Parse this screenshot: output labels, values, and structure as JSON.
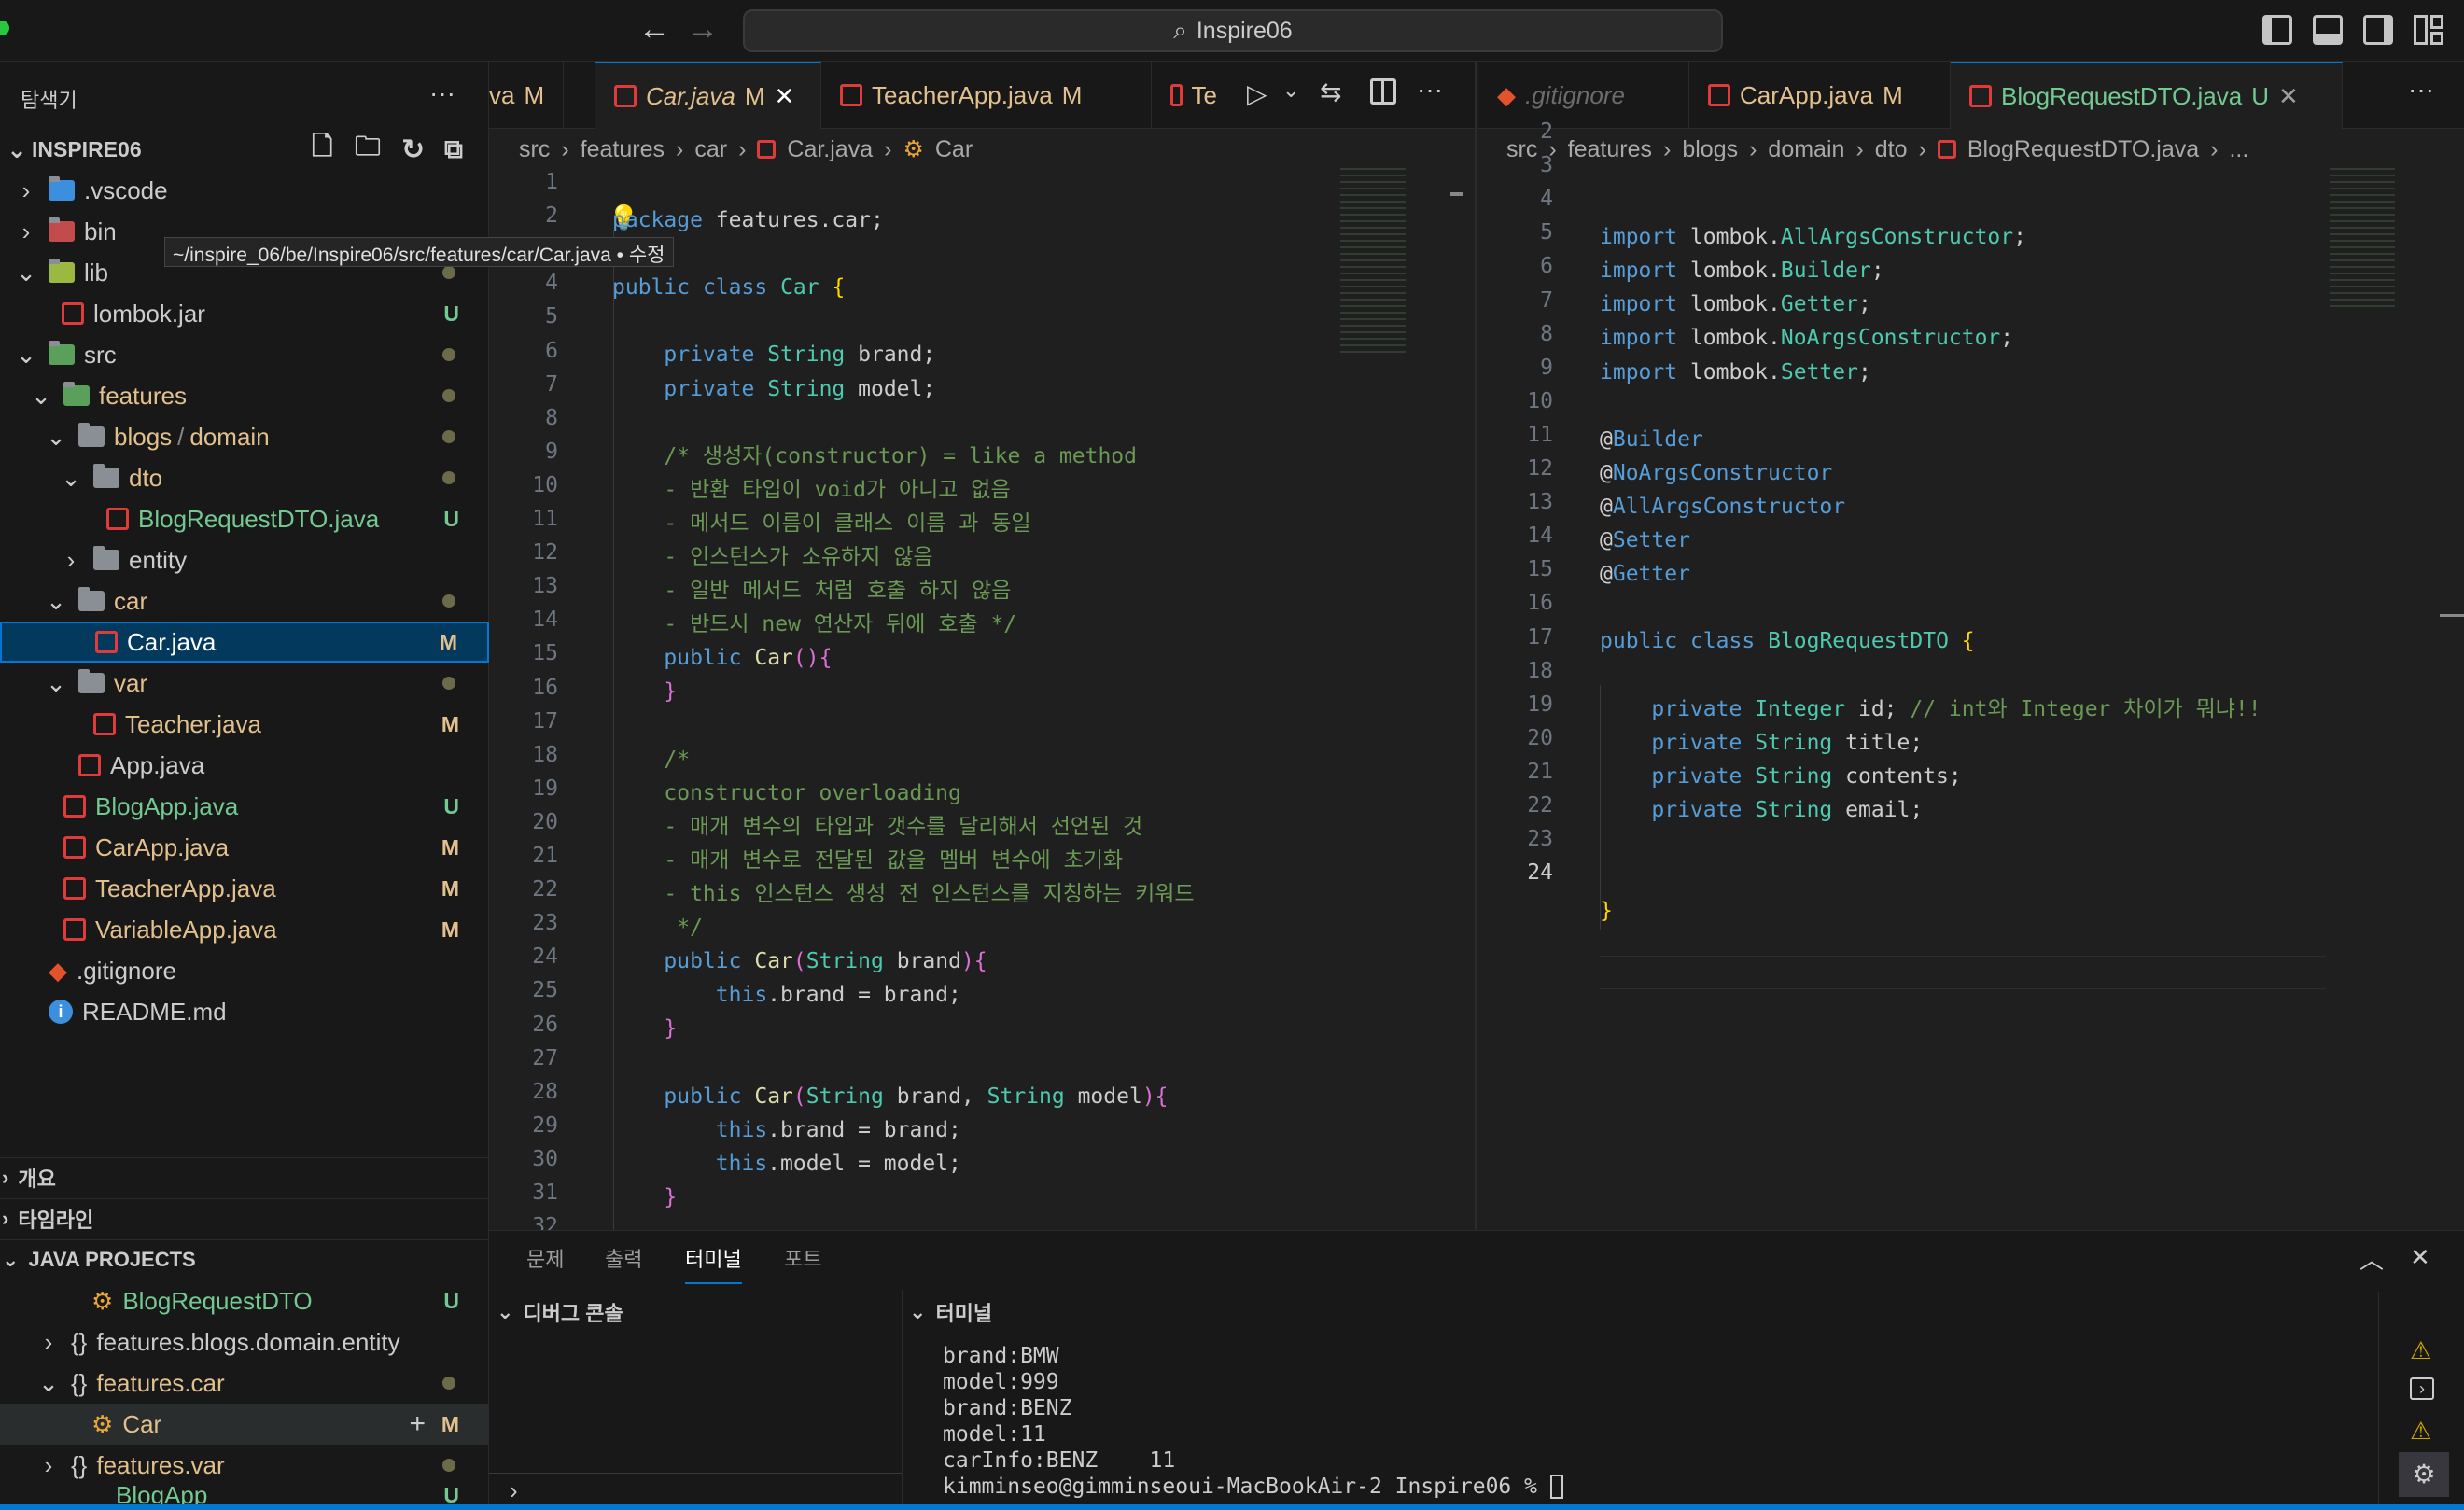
{
  "titlebar": {
    "search_text": "Inspire06"
  },
  "explorer": {
    "title": "탐색기",
    "more": "···",
    "root": "INSPIRE06",
    "tooltip": "~/inspire_06/be/Inspire06/src/features/car/Car.java • 수정",
    "items": [
      {
        "label": ".vscode",
        "badge": ""
      },
      {
        "label": "bin",
        "badge": ""
      },
      {
        "label": "lib",
        "badge": ""
      },
      {
        "label": "lombok.jar",
        "badge": "U"
      },
      {
        "label": "src",
        "badge": ""
      },
      {
        "label": "features",
        "badge": ""
      },
      {
        "label": "blogs",
        "label2": "domain",
        "badge": ""
      },
      {
        "label": "dto",
        "badge": ""
      },
      {
        "label": "BlogRequestDTO.java",
        "badge": "U"
      },
      {
        "label": "entity",
        "badge": ""
      },
      {
        "label": "car",
        "badge": ""
      },
      {
        "label": "Car.java",
        "badge": "M"
      },
      {
        "label": "var",
        "badge": ""
      },
      {
        "label": "Teacher.java",
        "badge": "M"
      },
      {
        "label": "App.java",
        "badge": ""
      },
      {
        "label": "BlogApp.java",
        "badge": "U"
      },
      {
        "label": "CarApp.java",
        "badge": "M"
      },
      {
        "label": "TeacherApp.java",
        "badge": "M"
      },
      {
        "label": "VariableApp.java",
        "badge": "M"
      },
      {
        "label": ".gitignore",
        "badge": ""
      },
      {
        "label": "README.md",
        "badge": ""
      }
    ],
    "sections": {
      "outline": "개요",
      "timeline": "타임라인",
      "java_projects": "JAVA PROJECTS"
    },
    "java_items": [
      {
        "label": "BlogRequestDTO",
        "badge": "U"
      },
      {
        "label": "features.blogs.domain.entity",
        "badge": ""
      },
      {
        "label": "features.car",
        "badge": ""
      },
      {
        "label": "Car",
        "badge": "M"
      },
      {
        "label": "features.var",
        "badge": ""
      },
      {
        "label": "BlogApp",
        "badge": "U"
      }
    ]
  },
  "editor_left": {
    "tabs": [
      {
        "label": "va",
        "badge": "M"
      },
      {
        "label": "Car.java",
        "badge": "M"
      },
      {
        "label": "TeacherApp.java",
        "badge": "M"
      },
      {
        "label": "Te",
        "badge": ""
      }
    ],
    "breadcrumb": [
      "src",
      "features",
      "car",
      "Car.java",
      "Car"
    ],
    "lines": [
      "1",
      "2",
      "3",
      "4",
      "5",
      "6",
      "7",
      "8",
      "9",
      "10",
      "11",
      "12",
      "13",
      "14",
      "15",
      "16",
      "17",
      "18",
      "19",
      "20",
      "21",
      "22",
      "23",
      "24",
      "25",
      "26",
      "27",
      "28",
      "29",
      "30",
      "31",
      "32"
    ]
  },
  "editor_right": {
    "tabs": [
      {
        "label": ".gitignore",
        "badge": ""
      },
      {
        "label": "CarApp.java",
        "badge": "M"
      },
      {
        "label": "BlogRequestDTO.java",
        "badge": "U"
      }
    ],
    "breadcrumb": [
      "src",
      "features",
      "blogs",
      "domain",
      "dto",
      "BlogRequestDTO.java",
      "..."
    ],
    "lines": [
      "2",
      "3",
      "4",
      "5",
      "6",
      "7",
      "8",
      "9",
      "10",
      "11",
      "12",
      "13",
      "14",
      "15",
      "16",
      "17",
      "18",
      "19",
      "20",
      "21",
      "22",
      "23",
      "24"
    ]
  },
  "panel": {
    "tabs": [
      "문제",
      "출력",
      "터미널",
      "포트"
    ],
    "debug_console": "디버그 콘솔",
    "terminal_title": "터미널",
    "terminal_lines": [
      "brand:BMW",
      "model:999",
      "brand:BENZ",
      "model:11",
      "carInfo:BENZ    11",
      "kimminseo@gimminseoui-MacBookAir-2 Inspire06 % "
    ]
  }
}
